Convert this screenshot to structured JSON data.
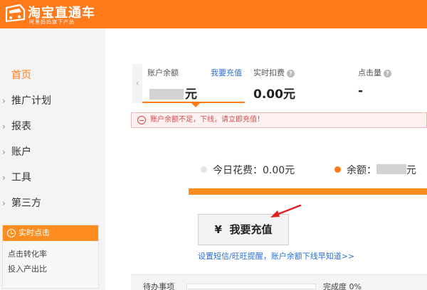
{
  "header": {
    "title": "淘宝直通车",
    "subtitle": "阿里妈妈旗下产品",
    "brand_color": "#ff7a1a"
  },
  "sidebar": {
    "items": [
      {
        "label": "首页",
        "active": true
      },
      {
        "label": "推广计划",
        "active": false
      },
      {
        "label": "报表",
        "active": false
      },
      {
        "label": "账户",
        "active": false
      },
      {
        "label": "工具",
        "active": false
      },
      {
        "label": "第三方",
        "active": false
      }
    ],
    "realtime": {
      "title": "实时点击",
      "links": [
        "点击转化率",
        "投入产出比"
      ]
    }
  },
  "stats": {
    "balance": {
      "label": "账户余额",
      "link": "我要充值",
      "value_suffix": "元"
    },
    "realtime_deduction": {
      "label": "实时扣费",
      "value": "0.00元"
    },
    "clicks": {
      "label": "点击量",
      "value": "-"
    }
  },
  "alert": {
    "text": "账户余额不足，下线，请立即充值！"
  },
  "summary": {
    "today_spend": "今日花费：0.00元",
    "balance_label": "余额：",
    "balance_suffix": "元"
  },
  "recharge_button": {
    "icon": "¥",
    "label": "我要充值"
  },
  "notify_link": "设置短信/旺旺提醒，账户余额下线早知道>>",
  "todo": {
    "label": "待办事项",
    "progress_text": "完成度 0%",
    "progress": 0
  }
}
